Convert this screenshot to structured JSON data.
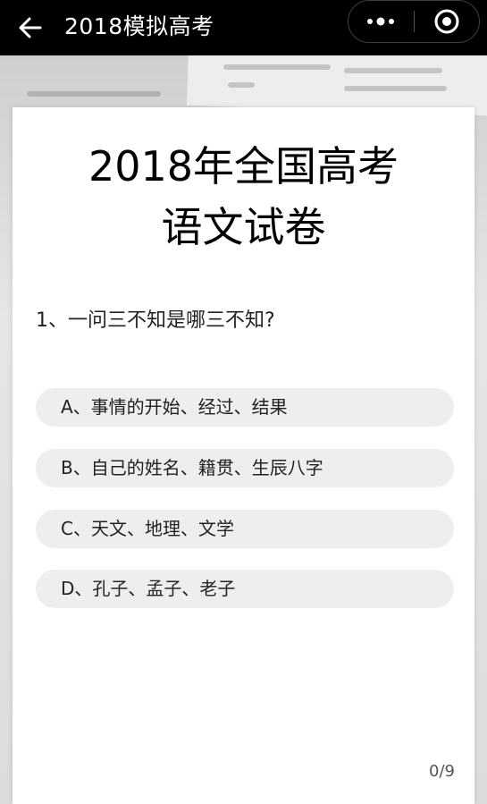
{
  "nav": {
    "title": "2018模拟高考",
    "back_icon": "back-arrow-icon",
    "more_icon": "more-dots-icon",
    "close_icon": "close-target-icon"
  },
  "paper": {
    "title_line1": "2018年全国高考",
    "title_line2": "语文试卷"
  },
  "question": {
    "text": "1、一问三不知是哪三不知?",
    "options": [
      {
        "label": "A、事情的开始、经过、结果"
      },
      {
        "label": "B、自己的姓名、籍贯、生辰八字"
      },
      {
        "label": "C、天文、地理、文学"
      },
      {
        "label": "D、孔子、孟子、老子"
      }
    ]
  },
  "progress": "0/9",
  "colors": {
    "nav_bg": "#000000",
    "option_bg": "#eeeeee",
    "card_bg": "#ffffff"
  }
}
